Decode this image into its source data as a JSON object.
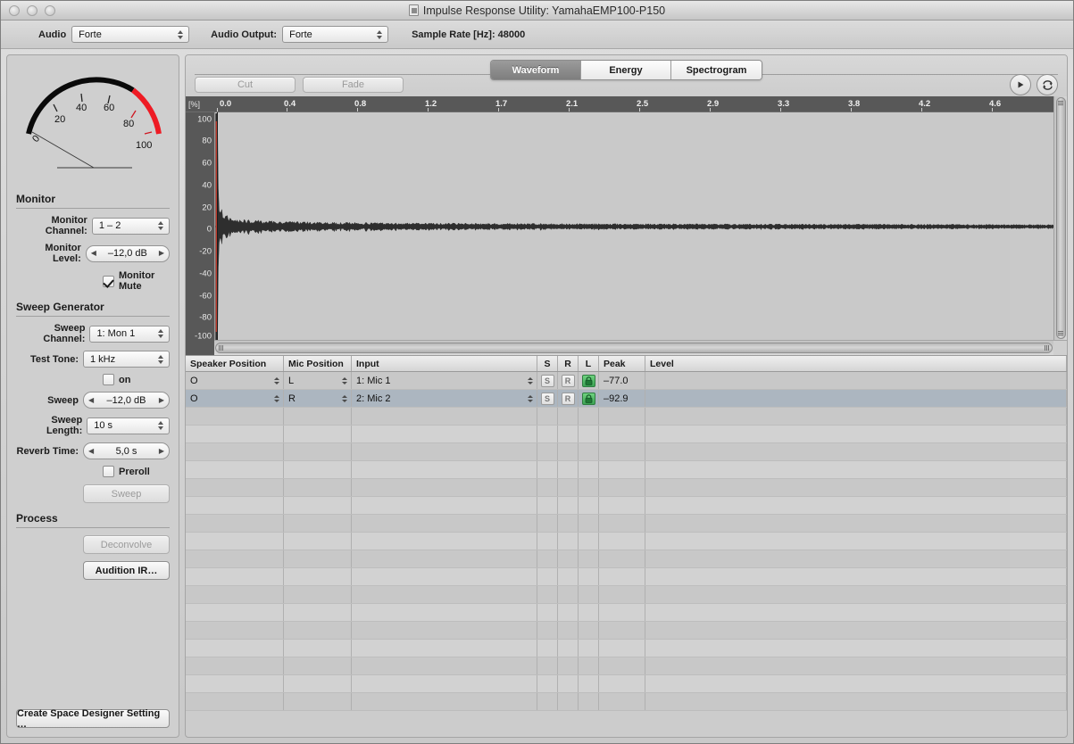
{
  "window": {
    "title": "Impulse Response Utility: YamahaEMP100-P150",
    "doc_icon": "document-icon"
  },
  "toolbar": {
    "audio_label": "Audio",
    "audio_value": "Forte",
    "audio_output_label": "Audio Output:",
    "audio_output_value": "Forte",
    "sample_rate": "Sample Rate [Hz]: 48000"
  },
  "meter": {
    "ticks": [
      "0",
      "20",
      "40",
      "60",
      "80",
      "100"
    ],
    "value": 0,
    "arc_color": "#000000",
    "danger_color": "#ee1b24",
    "danger_start": 70
  },
  "monitor": {
    "section": "Monitor",
    "channel_label": "Monitor Channel:",
    "channel_value": "1 – 2",
    "level_label": "Monitor  Level:",
    "level_value": "–12,0 dB",
    "mute_label": "Monitor Mute",
    "mute_checked": true
  },
  "sweep": {
    "section": "Sweep Generator",
    "channel_label": "Sweep Channel:",
    "channel_value": "1: Mon 1",
    "test_tone_label": "Test Tone:",
    "test_tone_value": "1 kHz",
    "on_label": "on",
    "on_checked": false,
    "sweep_label": "Sweep",
    "sweep_value": "–12,0 dB",
    "length_label": "Sweep Length:",
    "length_value": "10 s",
    "reverb_label": "Reverb Time:",
    "reverb_value": "5,0 s",
    "preroll_label": "Preroll",
    "preroll_checked": false,
    "sweep_button": "Sweep"
  },
  "process": {
    "section": "Process",
    "deconvolve": "Deconvolve",
    "audition": "Audition IR…"
  },
  "footer": {
    "create_button": "Create Space Designer Setting …"
  },
  "view": {
    "tabs": [
      {
        "label": "Waveform",
        "active": true
      },
      {
        "label": "Energy",
        "active": false
      },
      {
        "label": "Spectrogram",
        "active": false
      }
    ],
    "cut_button": "Cut",
    "fade_button": "Fade",
    "play_icon": "play-icon",
    "loop_icon": "loop-icon"
  },
  "chart_data": {
    "type": "line",
    "title": "",
    "xlabel": "",
    "ylabel": "[%]",
    "unit_label": "[%]",
    "x_ticks": [
      "0.0",
      "0.4",
      "0.8",
      "1.2",
      "1.7",
      "2.1",
      "2.5",
      "2.9",
      "3.3",
      "3.8",
      "4.2",
      "4.6"
    ],
    "y_ticks": [
      "100",
      "80",
      "60",
      "40",
      "20",
      "0",
      "-20",
      "-40",
      "-60",
      "-80",
      "-100"
    ],
    "ylim": [
      -100,
      100
    ],
    "xlim": [
      0.0,
      5.0
    ],
    "grid": false,
    "legend": "none",
    "series": [
      {
        "name": "Impulse Response",
        "description": "Sharp transient at t=0 decaying exponentially into low-level reverb tail",
        "envelope": [
          {
            "x": 0.0,
            "peak": 100
          },
          {
            "x": 0.004,
            "peak": 78
          },
          {
            "x": 0.008,
            "peak": 62
          },
          {
            "x": 0.012,
            "peak": 48
          },
          {
            "x": 0.018,
            "peak": 31
          },
          {
            "x": 0.025,
            "peak": 22
          },
          {
            "x": 0.035,
            "peak": 16
          },
          {
            "x": 0.05,
            "peak": 12
          },
          {
            "x": 0.08,
            "peak": 9
          },
          {
            "x": 0.12,
            "peak": 7
          },
          {
            "x": 0.2,
            "peak": 6
          },
          {
            "x": 0.35,
            "peak": 5
          },
          {
            "x": 0.6,
            "peak": 4
          },
          {
            "x": 1.0,
            "peak": 3.5
          },
          {
            "x": 1.6,
            "peak": 3
          },
          {
            "x": 2.4,
            "peak": 2.6
          },
          {
            "x": 3.4,
            "peak": 2.3
          },
          {
            "x": 4.6,
            "peak": 2.0
          },
          {
            "x": 5.0,
            "peak": 1.8
          }
        ]
      }
    ]
  },
  "table": {
    "columns": [
      "Speaker Position",
      "Mic Position",
      "Input",
      "S",
      "R",
      "L",
      "Peak",
      "Level"
    ],
    "rows": [
      {
        "speaker": "O",
        "mic": "L",
        "input": "1: Mic 1",
        "s": "S",
        "r": "R",
        "lock": "locked",
        "peak": "–77.0",
        "level": "",
        "selected": false
      },
      {
        "speaker": "O",
        "mic": "R",
        "input": "2: Mic 2",
        "s": "S",
        "r": "R",
        "lock": "locked",
        "peak": "–92.9",
        "level": "",
        "selected": true
      }
    ],
    "empty_rows": 17
  }
}
